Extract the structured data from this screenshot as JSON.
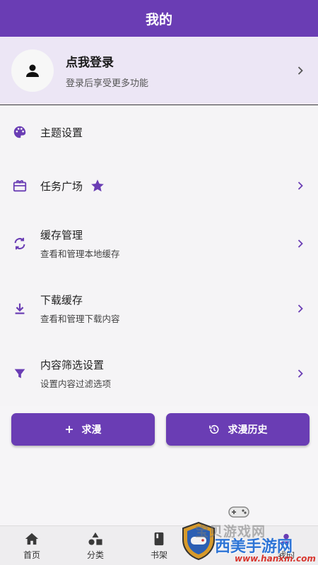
{
  "header": {
    "title": "我的"
  },
  "profile": {
    "title": "点我登录",
    "subtitle": "登录后享受更多功能"
  },
  "menu": {
    "items": [
      {
        "title": "主题设置",
        "subtitle": ""
      },
      {
        "title": "任务广场",
        "subtitle": ""
      },
      {
        "title": "缓存管理",
        "subtitle": "查看和管理本地缓存"
      },
      {
        "title": "下载缓存",
        "subtitle": "查看和管理下载内容"
      },
      {
        "title": "内容筛选设置",
        "subtitle": "设置内容过滤选项"
      }
    ]
  },
  "buttons": {
    "request": "求漫",
    "history": "求漫历史"
  },
  "tabs": [
    {
      "label": "首页"
    },
    {
      "label": "分类"
    },
    {
      "label": "书架"
    },
    {
      "label": ""
    },
    {
      "label": "我的"
    }
  ],
  "watermark": {
    "line1": "宝贝游戏网",
    "line2": "西美手游网",
    "url": "www.hanxm.com"
  },
  "colors": {
    "accent": "#6a3db4",
    "profile_bg": "#ece6f5",
    "page_bg": "#f6f5f7"
  }
}
